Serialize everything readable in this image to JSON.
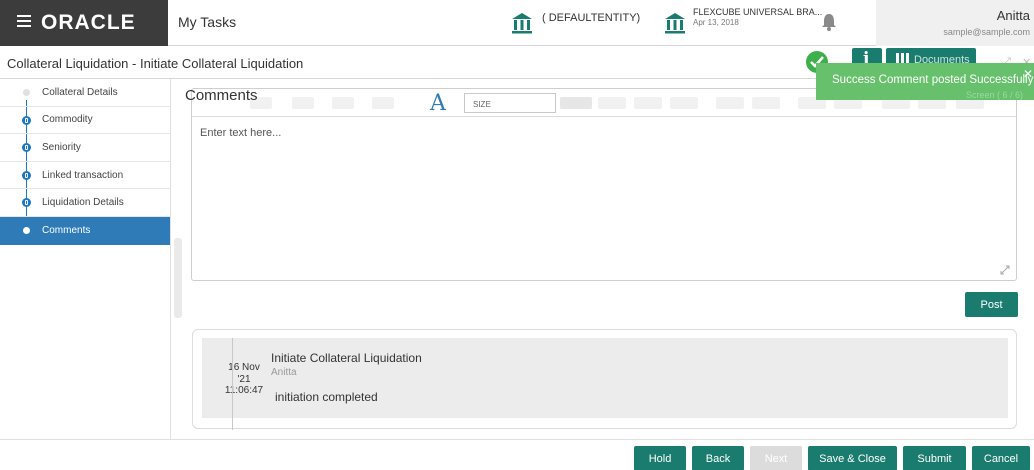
{
  "header": {
    "logo": "ORACLE",
    "app_title": "My Tasks",
    "entity": "( DEFAULTENTITY)",
    "branch_name": "FLEXCUBE UNIVERSAL BRA...",
    "branch_date": "Apr 13, 2018",
    "user_name": "Anitta",
    "user_email": "sample@sample.com"
  },
  "titlebar": {
    "title": "Collateral Liquidation - Initiate Collateral Liquidation",
    "documents_label": "Documents"
  },
  "toast": {
    "message": "Success Comment posted Successfully",
    "sub": "Screen ( 6 / 6)"
  },
  "sidebar": {
    "items": [
      {
        "label": "Collateral Details"
      },
      {
        "label": "Commodity"
      },
      {
        "label": "Seniority"
      },
      {
        "label": "Linked transaction"
      },
      {
        "label": "Liquidation Details"
      },
      {
        "label": "Comments"
      }
    ]
  },
  "main": {
    "heading": "Comments",
    "size_label": "SIZE",
    "editor_placeholder": "Enter text here...",
    "post_label": "Post",
    "history": [
      {
        "date_day": "16 Nov",
        "date_year": "'21",
        "time": "11:06:47",
        "title": "Initiate Collateral Liquidation",
        "user": "Anitta",
        "text": "initiation completed"
      }
    ]
  },
  "footer": {
    "hold": "Hold",
    "back": "Back",
    "next": "Next",
    "save_close": "Save & Close",
    "submit": "Submit",
    "cancel": "Cancel"
  },
  "colors": {
    "primary": "#1a7c6e",
    "active_nav": "#2e7bb8",
    "success": "#67c16c",
    "brand_dark": "#3c3c3c"
  }
}
